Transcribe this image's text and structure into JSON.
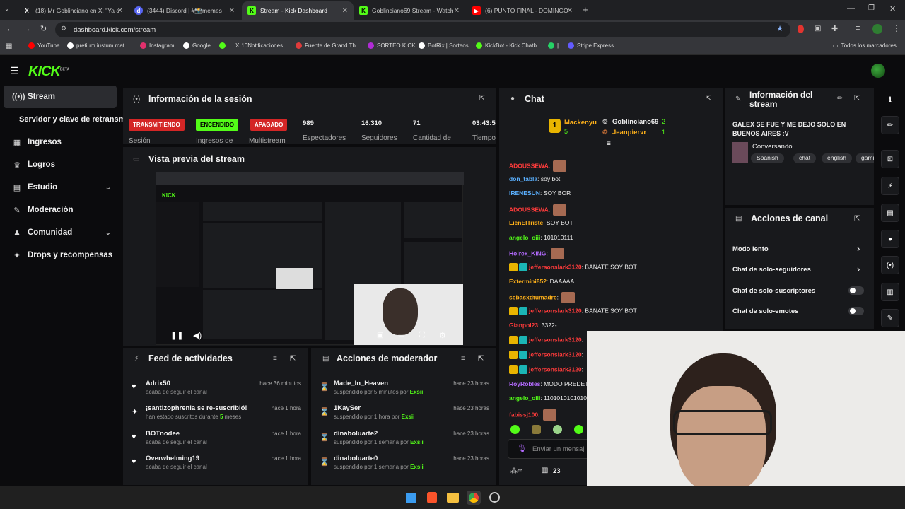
{
  "browser": {
    "tabs": [
      {
        "label": "(18) Mr Goblinciano en X: \"Ya c",
        "icon": "x-icon"
      },
      {
        "label": "(3444) Discord | #📸memes",
        "icon": "discord-icon"
      },
      {
        "label": "Stream - Kick Dashboard",
        "icon": "kick-icon"
      },
      {
        "label": "Goblinciano69 Stream - Watch",
        "icon": "kick-icon"
      },
      {
        "label": "(6) PUNTO FINAL - DOMINGO",
        "icon": "youtube-icon"
      }
    ],
    "url": "dashboard.kick.com/stream",
    "bookmarks": [
      {
        "label": "YouTube",
        "color": "#ff0000"
      },
      {
        "label": "pretium iustum mat...",
        "color": "#ffffff"
      },
      {
        "label": "Instagram",
        "color": "#e1306c"
      },
      {
        "label": "Google",
        "color": "#ffffff"
      },
      {
        "label": "",
        "color": "#53fc18"
      },
      {
        "label": "10Notificaciones",
        "color": "#ffffff"
      },
      {
        "label": "Fuente de Grand Th...",
        "color": "#e03b3b"
      },
      {
        "label": "SORTEO KICK",
        "color": "#b12bd6"
      },
      {
        "label": "BotRix | Sorteos",
        "color": "#ffffff"
      },
      {
        "label": "KickBot - Kick Chatb...",
        "color": "#53fc18"
      },
      {
        "label": "|",
        "color": "#25d366"
      },
      {
        "label": "Stripe Express",
        "color": "#635bff"
      }
    ],
    "all_bookmarks": "Todos los marcadores"
  },
  "kick": {
    "logo": "KICK",
    "beta": "BETA"
  },
  "sidebar": {
    "items": [
      {
        "label": "Stream",
        "icon": "broadcast-icon"
      },
      {
        "label": "Servidor y clave de retransm",
        "icon": ""
      },
      {
        "label": "Ingresos",
        "icon": "dollar-icon"
      },
      {
        "label": "Logros",
        "icon": "trophy-icon"
      },
      {
        "label": "Estudio",
        "icon": "studio-icon"
      },
      {
        "label": "Moderación",
        "icon": "wrench-icon"
      },
      {
        "label": "Comunidad",
        "icon": "community-icon"
      },
      {
        "label": "Drops y recompensas",
        "icon": "gift-icon"
      }
    ]
  },
  "session": {
    "title": "Información de la sesión",
    "badges": [
      {
        "text": "TRANSMITIENDO",
        "label": "Sesión",
        "color": "#d42626"
      },
      {
        "text": "ENCENDIDO",
        "label": "Ingresos de",
        "color": "#53fc18"
      },
      {
        "text": "APAGADO",
        "label": "Multistream",
        "color": "#d42626"
      }
    ],
    "stats": [
      {
        "value": "989",
        "label": "Espectadores"
      },
      {
        "value": "16.310",
        "label": "Seguidores"
      },
      {
        "value": "71",
        "label": "Cantidad de"
      },
      {
        "value": "03:43:5",
        "label": "Tiempo"
      }
    ]
  },
  "preview": {
    "title": "Vista previa del stream"
  },
  "activity": {
    "title": "Feed de actividades",
    "items": [
      {
        "icon": "heart-icon",
        "title": "Adrix50",
        "sub": "acaba de seguir el canal",
        "time": "hace 36 minutos"
      },
      {
        "icon": "sparkle-icon",
        "title": "¡santizophrenia se re-suscribió!",
        "sub_pre": "han estado suscritos durante ",
        "sub_num": "5",
        "sub_post": " meses",
        "time": "hace 1 hora"
      },
      {
        "icon": "heart-icon",
        "title": "BOTnodee",
        "sub": "acaba de seguir el canal",
        "time": "hace 1 hora"
      },
      {
        "icon": "heart-icon",
        "title": "Overwhelming19",
        "sub": "acaba de seguir el canal",
        "time": "hace 1 hora"
      }
    ]
  },
  "modactions": {
    "title": "Acciones de moderador",
    "items": [
      {
        "title": "Made_In_Heaven",
        "sub": "suspendido por 5 minutos por ",
        "by": "Exsii",
        "time": "hace 23 horas"
      },
      {
        "title": "1KaySer",
        "sub": "suspendido por 1 hora por ",
        "by": "Exsii",
        "time": "hace 23 horas"
      },
      {
        "title": "dinaboluarte2",
        "sub": "suspendido por 1 semana por ",
        "by": "Exsii",
        "time": "hace 23 horas"
      },
      {
        "title": "dinaboluarte0",
        "sub": "suspendido por 1 semana por ",
        "by": "Exsii",
        "time": "hace 23 horas"
      }
    ]
  },
  "chat": {
    "title": "Chat",
    "leaderboard": [
      {
        "rank": "1",
        "name": "Mackenyu",
        "count": "5"
      },
      {
        "name": "Goblinciano69",
        "count": "2"
      },
      {
        "name": "Jeanpiervr",
        "count": "1"
      }
    ],
    "messages": [
      {
        "user": "ADOUSSEWA",
        "color": "#ff3b3b",
        "text": "",
        "emote": true
      },
      {
        "user": "don_tabla",
        "color": "#5ab0ff",
        "text": "soy bot"
      },
      {
        "user": "IRENESUN",
        "color": "#5ab0ff",
        "text": "SOY BOR"
      },
      {
        "user": "ADOUSSEWA",
        "color": "#ff3b3b",
        "text": "",
        "emote": true
      },
      {
        "user": "LienElTriste",
        "color": "#ffb11a",
        "text": "SOY BOT"
      },
      {
        "user": "angelo_oiii",
        "color": "#53fc18",
        "text": "101010111"
      },
      {
        "user": "Holrex_KING",
        "color": "#b46bff",
        "text": "",
        "emote": true
      },
      {
        "user": "jeffersonslark3120",
        "color": "#ff3b3b",
        "text": "BAÑATE SOY BOT",
        "badges": true
      },
      {
        "user": "Extermini852",
        "color": "#ffb11a",
        "text": "DAAAAA"
      },
      {
        "user": "sebasxdtumadre",
        "color": "#ffb11a",
        "text": "",
        "emote": true
      },
      {
        "user": "jeffersonslark3120",
        "color": "#ff3b3b",
        "text": "BAÑATE SOY BOT",
        "badges": true
      },
      {
        "user": "Gianpol23",
        "color": "#ff3b3b",
        "text": "3322-"
      },
      {
        "user": "jeffersonslark3120",
        "color": "#ff3b3b",
        "text": "",
        "badges": true
      },
      {
        "user": "jeffersonslark3120",
        "color": "#ff3b3b",
        "text": "",
        "badges": true
      },
      {
        "user": "jeffersonslark3120",
        "color": "#ff3b3b",
        "text": "",
        "badges": true
      },
      {
        "user": "RoyRobles",
        "color": "#b46bff",
        "text": "MODO PREDET"
      },
      {
        "user": "angelo_oiii",
        "color": "#53fc18",
        "text": "11010101010101"
      },
      {
        "user": "fabissj100",
        "color": "#ff3b3b",
        "text": "",
        "emote": true
      }
    ],
    "input_placeholder": "Enviar un mensaj",
    "viewer_count": "23"
  },
  "streaminfo": {
    "title": "Información del stream",
    "stream_title": "GALEX SE FUE Y ME DEJO SOLO EN BUENOS AIRES :V",
    "category": "Conversando",
    "tags": [
      "Spanish",
      "chat",
      "english",
      "gami"
    ]
  },
  "channelactions": {
    "title": "Acciones de canal",
    "options": [
      {
        "label": "Modo lento",
        "control": "arrow"
      },
      {
        "label": "Chat de solo-seguidores",
        "control": "arrow"
      },
      {
        "label": "Chat de solo-suscriptores",
        "control": "toggle"
      },
      {
        "label": "Chat de solo-emotes",
        "control": "toggle"
      }
    ]
  },
  "colors": {
    "accent": "#53fc18",
    "panel": "#18191c",
    "danger": "#d42626"
  }
}
